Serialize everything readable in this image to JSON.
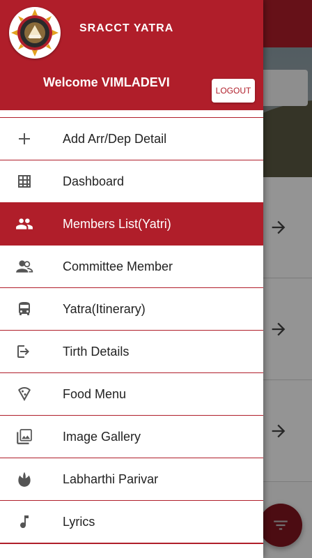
{
  "app": {
    "title": "SRACCT YATRA"
  },
  "header": {
    "welcome": "Welcome VIMLADEVI",
    "logout_label": "LOGOUT"
  },
  "colors": {
    "primary": "#b01e2a",
    "active_bg": "#b01e2a",
    "icon": "#555555"
  },
  "menu": {
    "items": [
      {
        "label": "Add Arr/Dep Detail",
        "icon": "plus-icon",
        "active": false
      },
      {
        "label": "Dashboard",
        "icon": "grid-icon",
        "active": false
      },
      {
        "label": "Members List(Yatri)",
        "icon": "people-icon",
        "active": true
      },
      {
        "label": "Committee Member",
        "icon": "group-icon",
        "active": false
      },
      {
        "label": "Yatra(Itinerary)",
        "icon": "bus-icon",
        "active": false
      },
      {
        "label": "Tirth Details",
        "icon": "login-icon",
        "active": false
      },
      {
        "label": "Food Menu",
        "icon": "pizza-icon",
        "active": false
      },
      {
        "label": "Image Gallery",
        "icon": "gallery-icon",
        "active": false
      },
      {
        "label": "Labharthi Parivar",
        "icon": "lotus-icon",
        "active": false
      },
      {
        "label": "Lyrics",
        "icon": "music-note-icon",
        "active": false
      }
    ]
  },
  "background": {
    "rows": [
      {
        "action_icon": "arrow-right-icon"
      },
      {
        "action_icon": "arrow-right-icon"
      },
      {
        "action_icon": "arrow-right-icon"
      }
    ],
    "fab_icon": "filter-icon"
  }
}
